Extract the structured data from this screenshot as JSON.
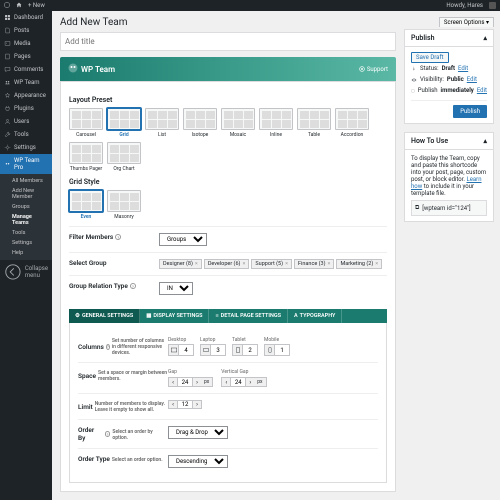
{
  "adminbar": {
    "site": "",
    "new": "New",
    "howdy": "Howdy, Hares"
  },
  "sidebar": {
    "items": [
      {
        "icon": "dashboard",
        "label": "Dashboard"
      },
      {
        "icon": "posts",
        "label": "Posts"
      },
      {
        "icon": "media",
        "label": "Media"
      },
      {
        "icon": "pages",
        "label": "Pages"
      },
      {
        "icon": "comments",
        "label": "Comments"
      },
      {
        "icon": "wpteam",
        "label": "WP Team"
      },
      {
        "icon": "appearance",
        "label": "Appearance"
      },
      {
        "icon": "plugins",
        "label": "Plugins"
      },
      {
        "icon": "users",
        "label": "Users"
      },
      {
        "icon": "tools",
        "label": "Tools"
      },
      {
        "icon": "settings",
        "label": "Settings"
      },
      {
        "icon": "wpteampro",
        "label": "WP Team Pro"
      }
    ],
    "submenu": [
      "All Members",
      "Add New Member",
      "Groups",
      "Manage Teams",
      "Tools",
      "Settings",
      "Help"
    ],
    "submenu_current": "Manage Teams",
    "collapse": "Collapse menu"
  },
  "screen_options": "Screen Options",
  "page_title": "Add New Team",
  "title_placeholder": "Add title",
  "brand": {
    "name": "WP Team",
    "support": "Support"
  },
  "layout_preset": {
    "label": "Layout Preset",
    "items": [
      "Carousel",
      "Grid",
      "List",
      "Isotope",
      "Mosaic",
      "Inline",
      "Table",
      "Accordion",
      "Thumbs Pager",
      "Org Chart"
    ],
    "active": "Grid"
  },
  "grid_style": {
    "label": "Grid Style",
    "items": [
      "Even",
      "Masonry"
    ],
    "active": "Even"
  },
  "filter_members": {
    "label": "Filter Members",
    "value": "Groups"
  },
  "select_group": {
    "label": "Select Group",
    "chips": [
      "Designer (8)",
      "Developer (6)",
      "Support (5)",
      "Finance (3)",
      "Marketing (2)"
    ]
  },
  "group_relation": {
    "label": "Group Relation Type",
    "value": "IN"
  },
  "tabs": [
    "GENERAL SETTINGS",
    "DISPLAY SETTINGS",
    "DETAIL PAGE SETTINGS",
    "TYPOGRAPHY"
  ],
  "active_tab": "GENERAL SETTINGS",
  "columns": {
    "label": "Columns",
    "desc": "Set number of columns in different responsive devices.",
    "fields": [
      {
        "name": "Desktop",
        "val": "4"
      },
      {
        "name": "Laptop",
        "val": "3"
      },
      {
        "name": "Tablet",
        "val": "2"
      },
      {
        "name": "Mobile",
        "val": "1"
      }
    ]
  },
  "space": {
    "label": "Space",
    "desc": "Set a space or margin between members.",
    "gap": {
      "label": "Gap",
      "val": "24",
      "unit": "px"
    },
    "vgap": {
      "label": "Vertical Gap",
      "val": "24",
      "unit": "px"
    }
  },
  "limit": {
    "label": "Limit",
    "desc": "Number of members to display. Leave it empty to show all.",
    "val": "12"
  },
  "order_by": {
    "label": "Order By",
    "desc": "Select an order by option.",
    "value": "Drag & Drop"
  },
  "order_type": {
    "label": "Order Type",
    "desc": "Select an order option.",
    "value": "Descending"
  },
  "publish": {
    "title": "Publish",
    "save_draft": "Save Draft",
    "status_label": "Status:",
    "status": "Draft",
    "visibility_label": "Visibility:",
    "visibility": "Public",
    "publish_label": "Publish",
    "publish_val": "immediately",
    "edit": "Edit",
    "button": "Publish"
  },
  "howto": {
    "title": "How To Use",
    "text": "To display the Team, copy and paste this shortcode into your post, page, custom post, or block editor. ",
    "learn": "Learn how",
    "text2": " to include it in your template file.",
    "code": "[wpteam id=\"124\"]"
  }
}
